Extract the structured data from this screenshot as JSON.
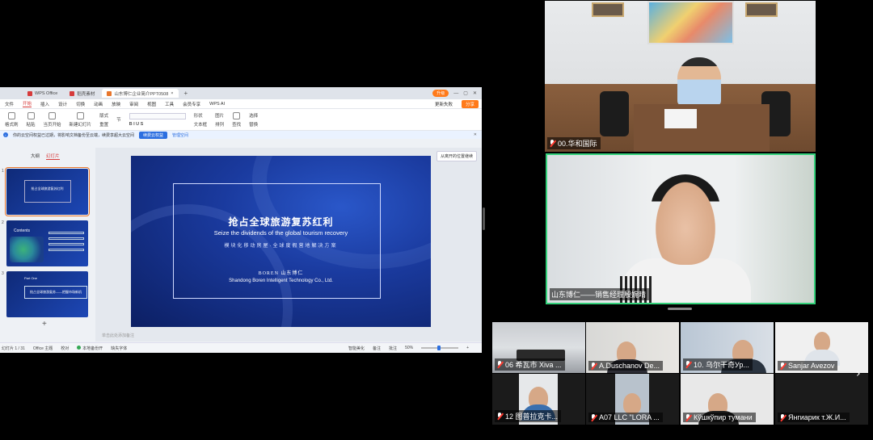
{
  "wps": {
    "tabs": [
      {
        "label": "WPS Office"
      },
      {
        "label": "稻壳素材"
      },
      {
        "label": "山东博仁企业简介PPT0508"
      }
    ],
    "upgrade_label": "升级",
    "menu": [
      "文件",
      "开始",
      "插入",
      "设计",
      "切换",
      "动画",
      "放映",
      "审阅",
      "视图",
      "工具",
      "会员专享",
      "WPS AI"
    ],
    "active_menu": "开始",
    "right_menu": {
      "review": "更新失败",
      "share": "分享"
    },
    "ribbon": {
      "format_painter": "格式刷",
      "paste": "粘贴",
      "from_start": "当页开始",
      "new_slide": "新建幻灯片",
      "layout": "版式",
      "reset": "重置",
      "section": "节",
      "font_buttons": "B  I  U  S",
      "shape": "形状",
      "picture": "图片",
      "textbox": "文本框",
      "arrange": "排列",
      "find": "查找",
      "select": "选择",
      "replace": "替换"
    },
    "notice": {
      "text": "你的云空间权益已过期，将影响文档备份至云端，续费享超大云空间",
      "renew": "续费云权益",
      "manage": "管理空间"
    },
    "panel_tabs": {
      "outline": "大纲",
      "slides": "幻灯片"
    },
    "thumbs": {
      "t1_title": "抢占全球旅游复苏红利",
      "t2_title": "Contents",
      "t3_tag": "Part One",
      "t3_text": "抢占全球旅游复苏——把握市场新机"
    },
    "float_button": "从离开的位置继续",
    "slide": {
      "title": "抢占全球旅游复苏红利",
      "subtitle": "Seize the dividends of the global tourism recovery",
      "tagline": "模块化移动房屋·全球度假营地解决方案",
      "brand": "BOREN 山东博仁",
      "company": "Shandong Boren Intelligent Technology Co., Ltd."
    },
    "notes_hint": "单击此处添加备注",
    "status": {
      "page": "幻灯片 1 / 31",
      "theme": "Office 主题",
      "proof": "校对",
      "backup": "本地备份开",
      "font_missing": "缺失字体",
      "beautify": "智能美化",
      "notes": "备注",
      "comments": "批注",
      "zoom": "50%"
    }
  },
  "participants": {
    "room": "00.华和国际",
    "speaker": "山东博仁——销售经理殷婉晴",
    "gallery": [
      "06 希瓦市 Xiva ...",
      "A.Duschanov De...",
      "10. 乌尔干奇Ур...",
      "Sanjar Avezov",
      "12 图普拉克卡...",
      "A07 LLC \"LORA ...",
      "Кўшкўпир тумани",
      "Янгиарик т.Ж.И..."
    ]
  },
  "nav": {
    "next": "›"
  }
}
